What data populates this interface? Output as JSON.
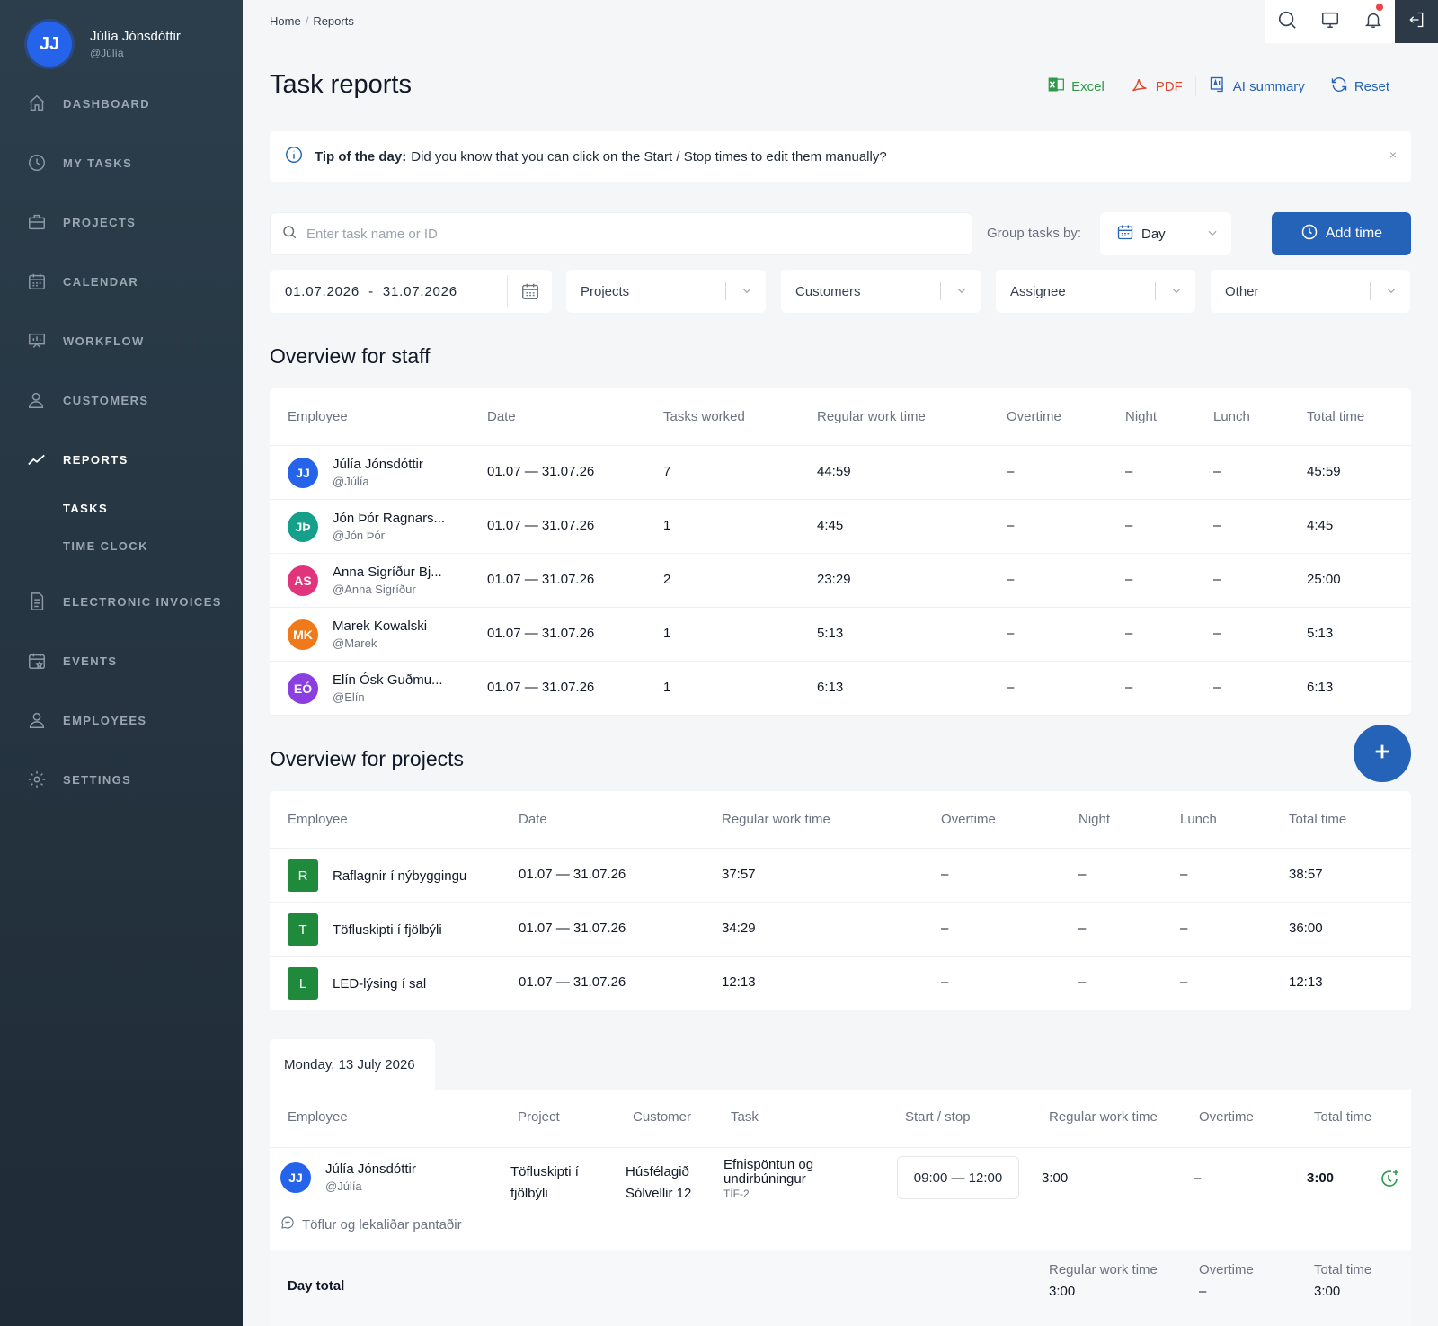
{
  "user": {
    "initials": "JJ",
    "name": "Júlía Jónsdóttir",
    "handle": "@Júlía"
  },
  "nav": {
    "dashboard": "DASHBOARD",
    "my_tasks": "MY TASKS",
    "projects": "PROJECTS",
    "calendar": "CALENDAR",
    "workflow": "WORKFLOW",
    "customers": "CUSTOMERS",
    "reports": "REPORTS",
    "tasks": "TASKS",
    "time_clock": "TIME CLOCK",
    "invoices": "ELECTRONIC INVOICES",
    "events": "EVENTS",
    "employees": "EMPLOYEES",
    "settings": "SETTINGS"
  },
  "breadcrumb": {
    "home": "Home",
    "sep": "/",
    "current": "Reports"
  },
  "page": {
    "title": "Task reports"
  },
  "actions": {
    "excel": "Excel",
    "pdf": "PDF",
    "ai": "AI summary",
    "reset": "Reset"
  },
  "colors": {
    "excel": "#2e9a4a",
    "pdf": "#e0492f",
    "accent": "#2563b8"
  },
  "tip": {
    "label": "Tip of the day:",
    "text": "Did you know that you can click on the Start / Stop times to edit them manually?",
    "close": "×"
  },
  "search": {
    "placeholder": "Enter task name or ID"
  },
  "group": {
    "label": "Group tasks by:",
    "value": "Day"
  },
  "add_time": "Add time",
  "filters": {
    "date_from": "01.07.2026",
    "date_sep": "-",
    "date_to": "31.07.2026",
    "projects": "Projects",
    "customers": "Customers",
    "assignee": "Assignee",
    "other": "Other"
  },
  "staff": {
    "title": "Overview for staff",
    "headers": [
      "Employee",
      "Date",
      "Tasks worked",
      "Regular work time",
      "Overtime",
      "Night",
      "Lunch",
      "Total time"
    ],
    "rows": [
      {
        "initials": "JJ",
        "color": "#2563eb",
        "name": "Júlía Jónsdóttir",
        "handle": "@Júlía",
        "date": "01.07 — 31.07.26",
        "tasks": "7",
        "regular": "44:59",
        "overtime": "–",
        "night": "–",
        "lunch": "–",
        "total": "45:59"
      },
      {
        "initials": "JÞ",
        "color": "#14a08a",
        "name": "Jón Þór Ragnars...",
        "handle": "@Jón Þór",
        "date": "01.07 — 31.07.26",
        "tasks": "1",
        "regular": "4:45",
        "overtime": "–",
        "night": "–",
        "lunch": "–",
        "total": "4:45"
      },
      {
        "initials": "AS",
        "color": "#e0357a",
        "name": "Anna Sigríður Bj...",
        "handle": "@Anna Sigríður",
        "date": "01.07 — 31.07.26",
        "tasks": "2",
        "regular": "23:29",
        "overtime": "–",
        "night": "–",
        "lunch": "–",
        "total": "25:00"
      },
      {
        "initials": "MK",
        "color": "#f07a1a",
        "name": "Marek Kowalski",
        "handle": "@Marek",
        "date": "01.07 — 31.07.26",
        "tasks": "1",
        "regular": "5:13",
        "overtime": "–",
        "night": "–",
        "lunch": "–",
        "total": "5:13"
      },
      {
        "initials": "EÓ",
        "color": "#8b3fe0",
        "name": "Elín Ósk Guðmu...",
        "handle": "@Elín",
        "date": "01.07 — 31.07.26",
        "tasks": "1",
        "regular": "6:13",
        "overtime": "–",
        "night": "–",
        "lunch": "–",
        "total": "6:13"
      }
    ]
  },
  "projects": {
    "title": "Overview for projects",
    "headers": [
      "Employee",
      "Date",
      "Regular work time",
      "Overtime",
      "Night",
      "Lunch",
      "Total time"
    ],
    "rows": [
      {
        "letter": "R",
        "name": "Raflagnir í nýbyggingu",
        "date": "01.07 — 31.07.26",
        "regular": "37:57",
        "overtime": "–",
        "night": "–",
        "lunch": "–",
        "total": "38:57"
      },
      {
        "letter": "T",
        "name": "Töfluskipti í fjölbýli",
        "date": "01.07 — 31.07.26",
        "regular": "34:29",
        "overtime": "–",
        "night": "–",
        "lunch": "–",
        "total": "36:00"
      },
      {
        "letter": "L",
        "name": "LED-lýsing í sal",
        "date": "01.07 — 31.07.26",
        "regular": "12:13",
        "overtime": "–",
        "night": "–",
        "lunch": "–",
        "total": "12:13"
      }
    ]
  },
  "day": {
    "tab": "Monday, 13 July 2026",
    "headers": [
      "Employee",
      "Project",
      "Customer",
      "Task",
      "Start / stop",
      "Regular work time",
      "Overtime",
      "Total time"
    ],
    "entry": {
      "initials": "JJ",
      "name": "Júlía Jónsdóttir",
      "handle": "@Júlía",
      "project_l1": "Töfluskipti í",
      "project_l2": "fjölbýli",
      "customer_l1": "Húsfélagið",
      "customer_l2": "Sólvellir 12",
      "task_l1": "Efnispöntun og",
      "task_l2": "undirbúningur",
      "task_id": "TÍF-2",
      "start_stop": "09:00 — 12:00",
      "regular": "3:00",
      "overtime": "–",
      "total": "3:00",
      "comment": "Töflur og lekaliðar pantaðir"
    },
    "total": {
      "label": "Day total",
      "regular_label": "Regular work time",
      "regular": "3:00",
      "overtime_label": "Overtime",
      "overtime": "–",
      "total_label": "Total time",
      "total": "3:00"
    }
  }
}
